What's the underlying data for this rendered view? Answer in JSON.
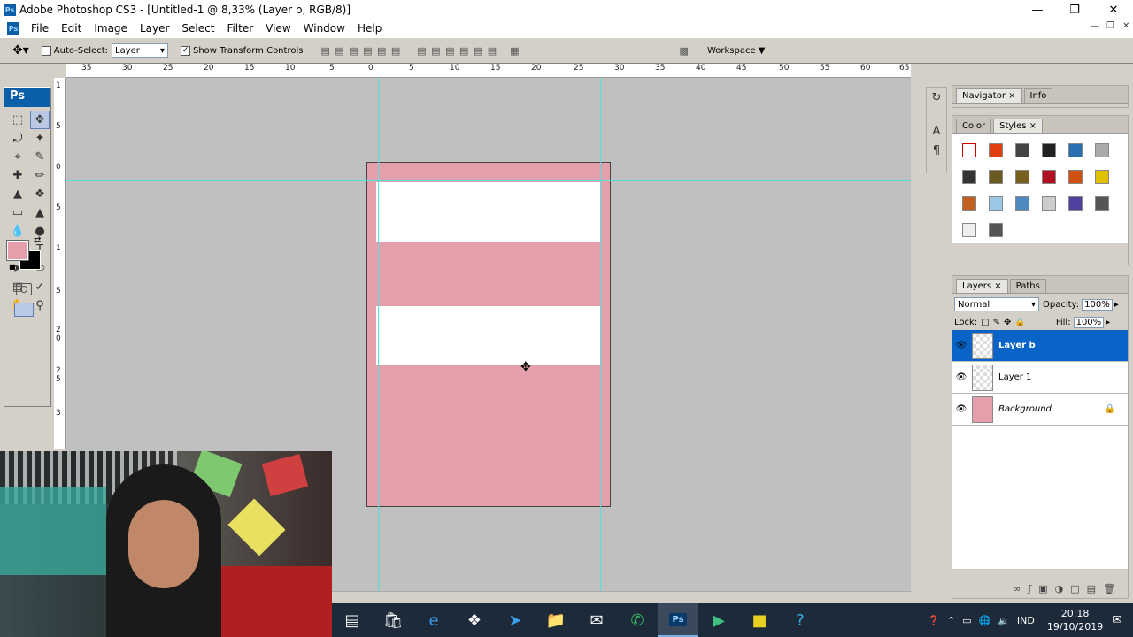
{
  "window": {
    "title": "Adobe Photoshop CS3 - [Untitled-1 @ 8,33% (Layer b, RGB/8)]",
    "app_icon": "Ps"
  },
  "menu": [
    "File",
    "Edit",
    "Image",
    "Layer",
    "Select",
    "Filter",
    "View",
    "Window",
    "Help"
  ],
  "options": {
    "auto_select_label": "Auto-Select:",
    "auto_select_value": "Layer",
    "show_transform_label": "Show Transform Controls",
    "workspace_label": "Workspace"
  },
  "toolbox": {
    "header": "Ps",
    "foreground_color": "#e3a0aa",
    "background_color": "#000000"
  },
  "rulers": {
    "horizontal": [
      "35",
      "30",
      "25",
      "20",
      "15",
      "10",
      "5",
      "0",
      "5",
      "10",
      "15",
      "20",
      "25",
      "30",
      "35",
      "40",
      "45",
      "50",
      "55",
      "60",
      "65"
    ],
    "vertical": [
      "1",
      "5",
      "0",
      "5",
      "1",
      "5",
      "2",
      "0",
      "2",
      "5",
      "3"
    ]
  },
  "document": {
    "fill_color": "#e3a0aa",
    "zoom": "8,33%"
  },
  "panels": {
    "navigator_tabs": [
      "Navigator",
      "Info"
    ],
    "color_tabs": [
      "Color",
      "Styles"
    ],
    "layers_tabs": [
      "Layers",
      "Paths"
    ],
    "blend_mode": "Normal",
    "opacity_label": "Opacity:",
    "opacity_value": "100%",
    "lock_label": "Lock:",
    "fill_label": "Fill:",
    "fill_value": "100%",
    "layers": [
      {
        "name": "Layer b",
        "selected": true
      },
      {
        "name": "Layer 1",
        "selected": false
      },
      {
        "name": "Background",
        "selected": false,
        "locked": true
      }
    ]
  },
  "taskbar": {
    "language": "IND",
    "time": "20:18",
    "date": "19/10/2019",
    "active_app": "Ps"
  }
}
